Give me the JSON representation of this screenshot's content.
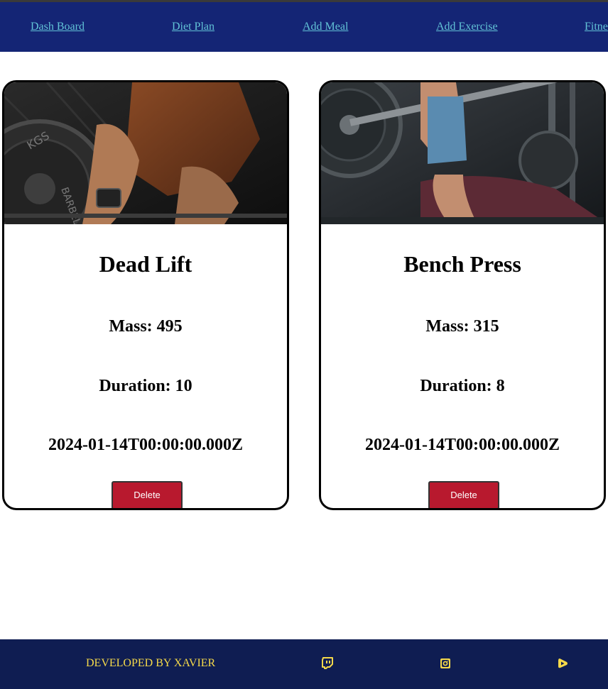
{
  "nav": {
    "links": [
      {
        "label": "Dash Board"
      },
      {
        "label": "Diet Plan"
      },
      {
        "label": "Add Meal"
      },
      {
        "label": "Add Exercise"
      },
      {
        "label": "Fitne"
      }
    ]
  },
  "cards": [
    {
      "image": "barbell-deadlift-photo",
      "title": "Dead Lift",
      "mass": "Mass: 495",
      "duration": "Duration: 10",
      "date": "2024-01-14T00:00:00.000Z",
      "delete_label": "Delete"
    },
    {
      "image": "bench-press-photo",
      "title": "Bench Press",
      "mass": "Mass: 315",
      "duration": "Duration: 8",
      "date": "2024-01-14T00:00:00.000Z",
      "delete_label": "Delete"
    }
  ],
  "footer": {
    "credit": "DEVELOPED BY XAVIER",
    "icons": [
      "twitch-icon",
      "instagram-icon",
      "rumble-icon"
    ]
  },
  "colors": {
    "navbar": "#142575",
    "nav_link": "#62c2d6",
    "footer": "#0f1d52",
    "footer_text": "#f5d94a",
    "delete_button": "#b8192e"
  }
}
